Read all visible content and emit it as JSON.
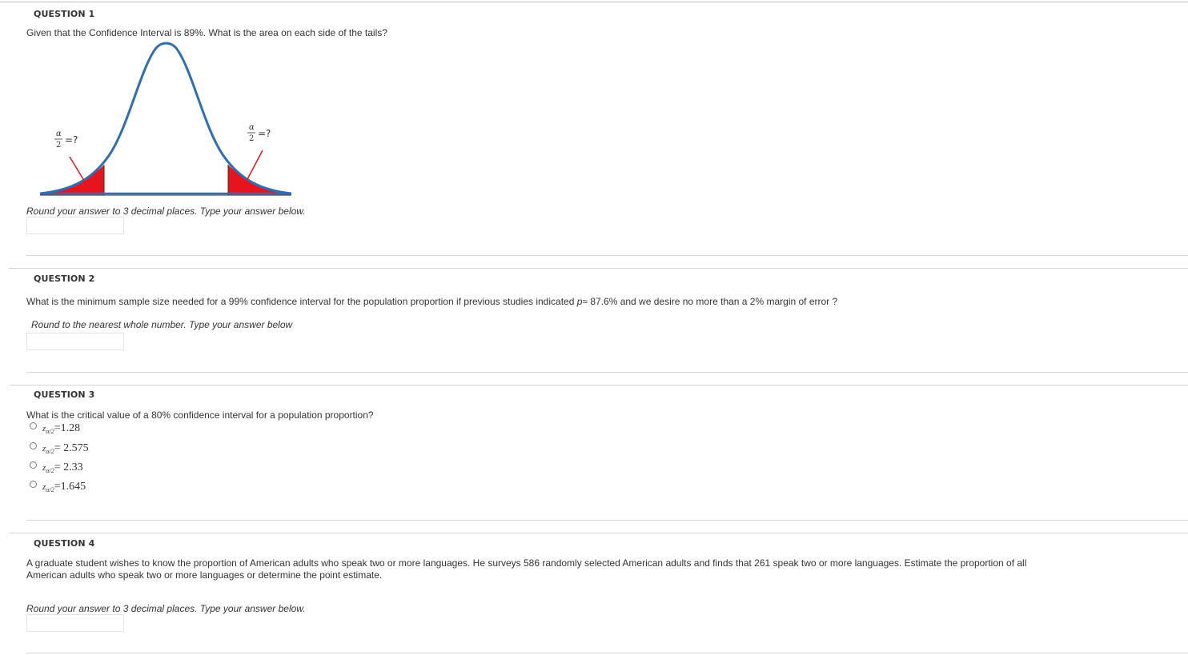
{
  "q1": {
    "heading": "QUESTION 1",
    "text": "Given that the Confidence Interval is 89%. What is the area on each side of the tails?",
    "figure": {
      "left_label": "=?",
      "right_label": "=?",
      "fraction_num": "α",
      "fraction_den": "2",
      "curve_color": "#2f6db5",
      "tail_color": "#e8141c"
    },
    "instruction": "Round your answer to 3 decimal places. Type your answer below.",
    "answer_value": ""
  },
  "q2": {
    "heading": "QUESTION 2",
    "text_before": "What is the minimum sample size needed for a 99% confidence interval for the population proportion if previous studies indicated",
    "p_symbol": "p",
    "approx_symbol": "≈",
    "text_after": "87.6% and we desire no more than a 2% margin of error ?",
    "instruction": "Round to the nearest whole number. Type your answer below",
    "answer_value": ""
  },
  "q3": {
    "heading": "QUESTION 3",
    "text": "What is the critical value of a 80% confidence interval for a population proportion?",
    "z_symbol": "z",
    "subscript": "α/2",
    "options": [
      {
        "value": "=1.28"
      },
      {
        "value": "= 2.575"
      },
      {
        "value": "= 2.33"
      },
      {
        "value": "=1.645"
      }
    ]
  },
  "q4": {
    "heading": "QUESTION 4",
    "text_line1": "A graduate student wishes to know the proportion of American adults who speak two or more languages. He surveys 586 randomly selected American adults and finds that 261 speak two or more languages. Estimate the proportion of all",
    "text_line2": "American adults who speak two or more languages or determine the point estimate.",
    "instruction": "Round your answer to 3 decimal places. Type your answer below.",
    "answer_value": ""
  }
}
